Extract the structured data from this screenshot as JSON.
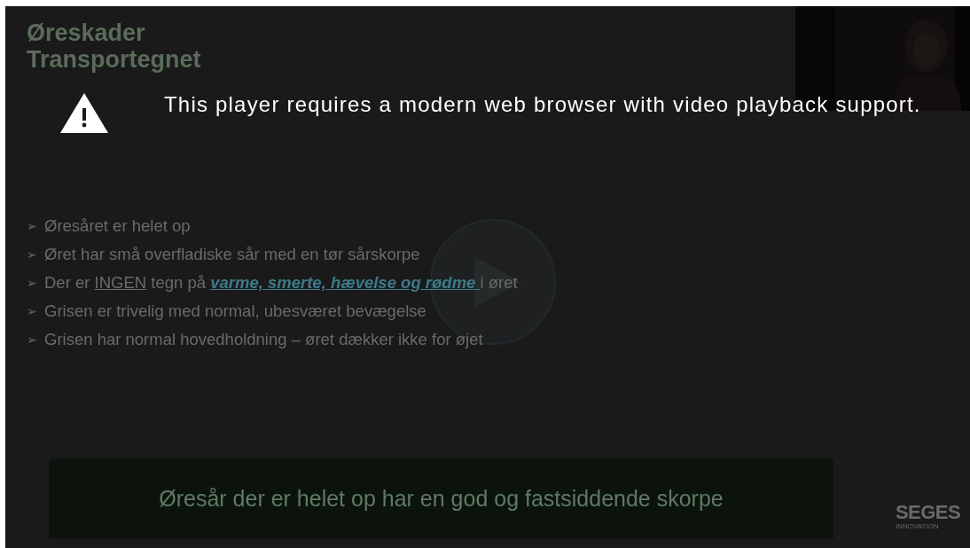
{
  "slide": {
    "title_lines": [
      "Øreskader",
      "Transportegnet"
    ],
    "bullets": [
      {
        "marker": "➢",
        "parts": [
          {
            "kind": "plain",
            "text": "Øresåret er helet op"
          }
        ]
      },
      {
        "marker": "➢",
        "parts": [
          {
            "kind": "plain",
            "text": "Øret har små overfladiske sår med en tør sårskorpe"
          }
        ]
      },
      {
        "marker": "➢",
        "parts": [
          {
            "kind": "plain",
            "text": "Der er "
          },
          {
            "kind": "underline",
            "text": "INGEN"
          },
          {
            "kind": "plain",
            "text": " tegn på "
          },
          {
            "kind": "link",
            "text": "varme, smerte, hævelse og rødme "
          },
          {
            "kind": "plain",
            "text": "i øret"
          }
        ]
      },
      {
        "marker": "➢",
        "parts": [
          {
            "kind": "plain",
            "text": "Grisen er trivelig med normal, ubesværet bevægelse"
          }
        ]
      },
      {
        "marker": "➢",
        "parts": [
          {
            "kind": "plain",
            "text": "Grisen har normal hovedholdning – øret dækker ikke for øjet"
          }
        ]
      }
    ],
    "caption": "Øresår der er helet op har en god og fastsiddende skorpe",
    "logo": {
      "name": "SEGES",
      "tagline": "INNOVATION"
    }
  },
  "error_message": "This player requires a modern web browser with video playback support."
}
